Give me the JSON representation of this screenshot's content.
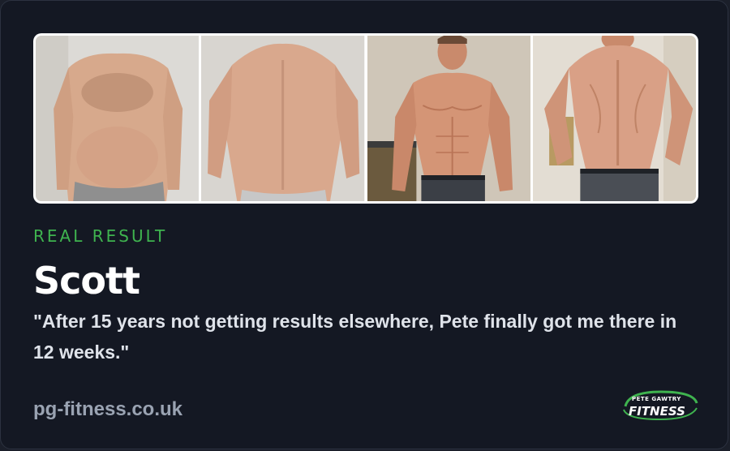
{
  "photos": [
    {
      "label": "before-front",
      "skin": "#d7a98c",
      "bg": "#dcdad6",
      "shorts": "#8f8f8f"
    },
    {
      "label": "before-back",
      "skin": "#d9a88d",
      "bg": "#d8d5d0",
      "shorts": "#c7c7c7"
    },
    {
      "label": "after-front",
      "skin": "#d49576",
      "bg": "#cfc6b8",
      "shorts": "#3b3f46"
    },
    {
      "label": "after-back",
      "skin": "#d9a086",
      "bg": "#e3ddd3",
      "shorts": "#4a4e55"
    }
  ],
  "eyebrow": "REAL RESULT",
  "name": "Scott",
  "quote": "\"After 15 years not getting results elsewhere, Pete finally got me there in 12 weeks.\"",
  "site": "pg-fitness.co.uk",
  "logo": {
    "top": "PETE GAWTRY",
    "bottom": "FITNESS",
    "accent": "#3fb34f"
  },
  "colors": {
    "background": "#141823",
    "accent": "#3fb34f",
    "text": "#ffffff",
    "muted": "#9aa3b2"
  }
}
